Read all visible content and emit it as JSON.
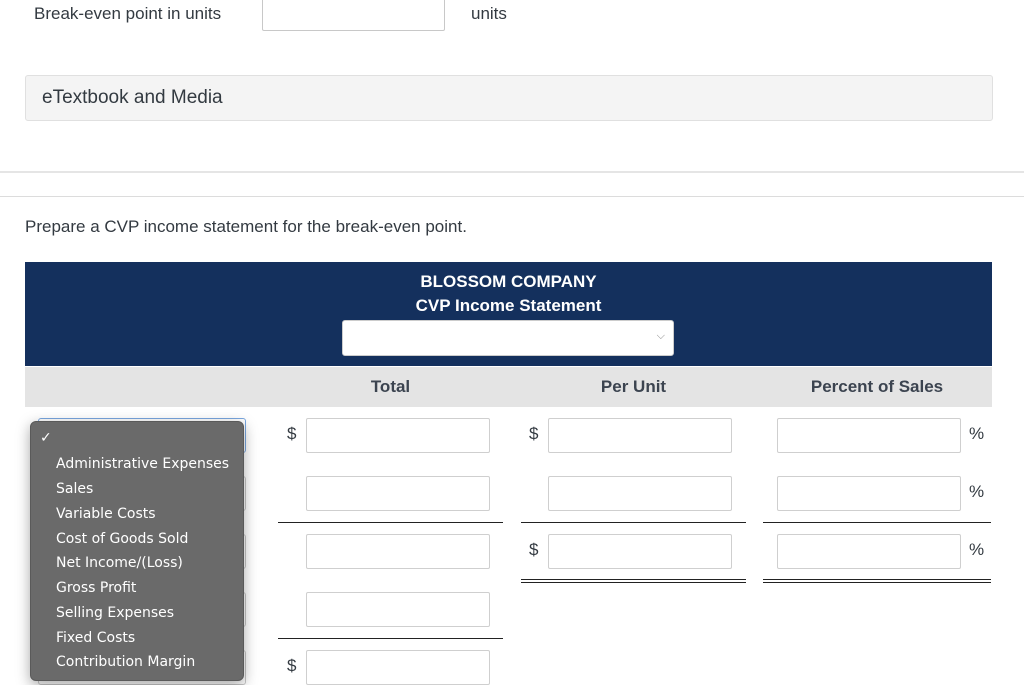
{
  "breakeven": {
    "label": "Break-even point in units",
    "value": "",
    "unit": "units"
  },
  "etextbook": {
    "label": "eTextbook and Media"
  },
  "instruction": "Prepare a CVP income statement for the break-even point.",
  "statement": {
    "company": "BLOSSOM COMPANY",
    "title": "CVP Income Statement",
    "period_value": "",
    "chevron_icon": "⌵",
    "columns": {
      "label": "",
      "total": "Total",
      "per_unit": "Per Unit",
      "percent": "Percent of Sales"
    },
    "currency_symbol": "$",
    "percent_symbol": "%"
  },
  "dropdown": {
    "check_icon": "✓",
    "options": [
      "",
      "Administrative Expenses",
      "Sales",
      "Variable Costs",
      "Cost of Goods Sold",
      "Net Income/(Loss)",
      "Gross Profit",
      "Selling Expenses",
      "Fixed Costs",
      "Contribution Margin"
    ],
    "selected_index": 0
  },
  "colors": {
    "header_bg": "#14305d",
    "column_header_bg": "#e4e4e4",
    "dropdown_bg": "#6a6a6a"
  }
}
